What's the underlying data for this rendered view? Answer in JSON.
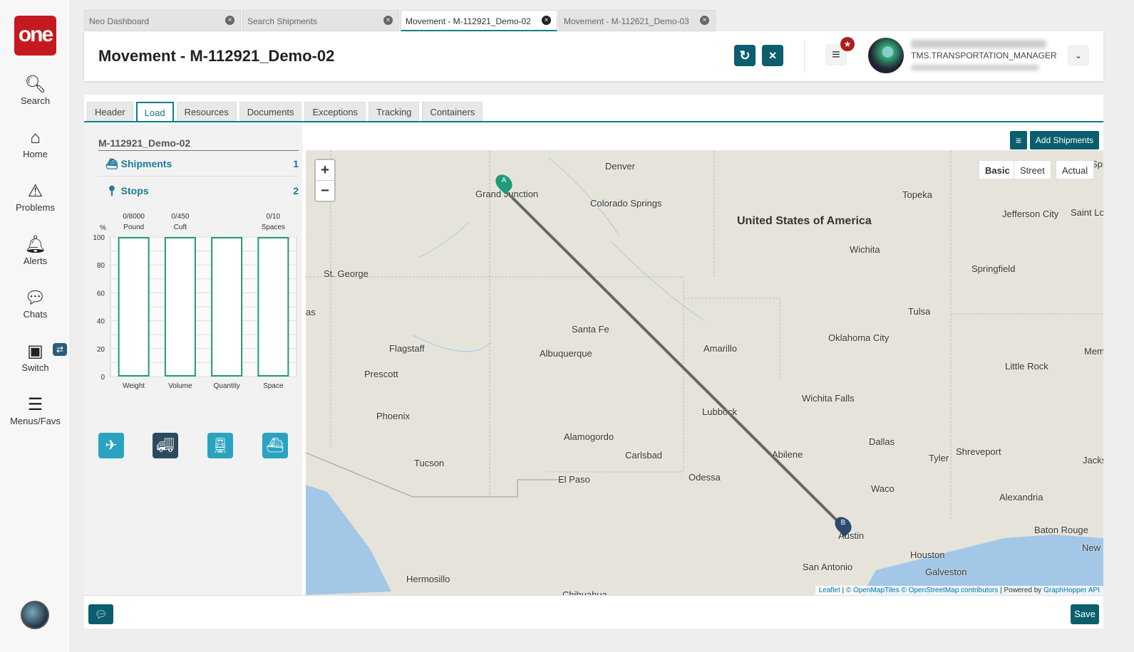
{
  "nav": {
    "logo": "one",
    "items": [
      "Search",
      "Home",
      "Problems",
      "Alerts",
      "Chats",
      "Switch",
      "Menus/Favs"
    ]
  },
  "tabs": [
    {
      "label": "Neo Dashboard"
    },
    {
      "label": "Search Shipments"
    },
    {
      "label": "Movement - M-112921_Demo-02"
    },
    {
      "label": "Movement - M-112621_Demo-03"
    }
  ],
  "header": {
    "title": "Movement - M-112921_Demo-02",
    "role": "TMS.TRANSPORTATION_MANAGER"
  },
  "subtabs": [
    "Header",
    "Load",
    "Resources",
    "Documents",
    "Exceptions",
    "Tracking",
    "Containers"
  ],
  "load": {
    "movement_id": "M-112921_Demo-02",
    "shipments_label": "Shipments",
    "shipments_count": "1",
    "stops_label": "Stops",
    "stops_count": "2"
  },
  "capacity": {
    "y_unit": "%",
    "y_ticks": [
      "100",
      "80",
      "60",
      "40",
      "20",
      "0"
    ],
    "bars": [
      {
        "label": "Weight",
        "top": "0/8000",
        "unit": "Pound",
        "percent": 0
      },
      {
        "label": "Volume",
        "top": "0/450",
        "unit": "Cuft",
        "percent": 0
      },
      {
        "label": "Quantity",
        "top": "",
        "unit": "",
        "percent": 0
      },
      {
        "label": "Space",
        "top": "0/10",
        "unit": "Spaces",
        "percent": 0
      }
    ],
    "bar_color": "#1f9a7a"
  },
  "actions": {
    "add_shipments": "Add Shipments",
    "save": "Save"
  },
  "map": {
    "types": [
      "Basic",
      "Street",
      "Actual"
    ],
    "country": "United States of America",
    "cities": [
      "Denver",
      "Grand Junction",
      "Colorado Springs",
      "Topeka",
      "Jefferson City",
      "Saint Lo",
      "Wichita",
      "Springfield",
      "St. George",
      "Tulsa",
      "Santa Fe",
      "Oklahoma City",
      "Flagstaff",
      "Albuquerque",
      "Amarillo",
      "Little Rock",
      "Prescott",
      "Memp",
      "Wichita Falls",
      "Phoenix",
      "Lubbock",
      "Dallas",
      "Alamogordo",
      "Shreveport",
      "Carlsbad",
      "Tyler",
      "Jackso",
      "Tucson",
      "Abilene",
      "El Paso",
      "Odessa",
      "Waco",
      "Alexandria",
      "Austin",
      "Baton Rouge",
      "Houston",
      "New Orl",
      "San Antonio",
      "Galveston",
      "Hermosillo",
      "Chihuahua",
      "Spri",
      "as"
    ],
    "markers": [
      "A",
      "B"
    ],
    "attribution": {
      "leaflet": "Leaflet",
      "omt": "© OpenMapTiles",
      "osm": "© OpenStreetMap contributors",
      "powered": "| Powered by",
      "gh": "GraphHopper API"
    }
  }
}
